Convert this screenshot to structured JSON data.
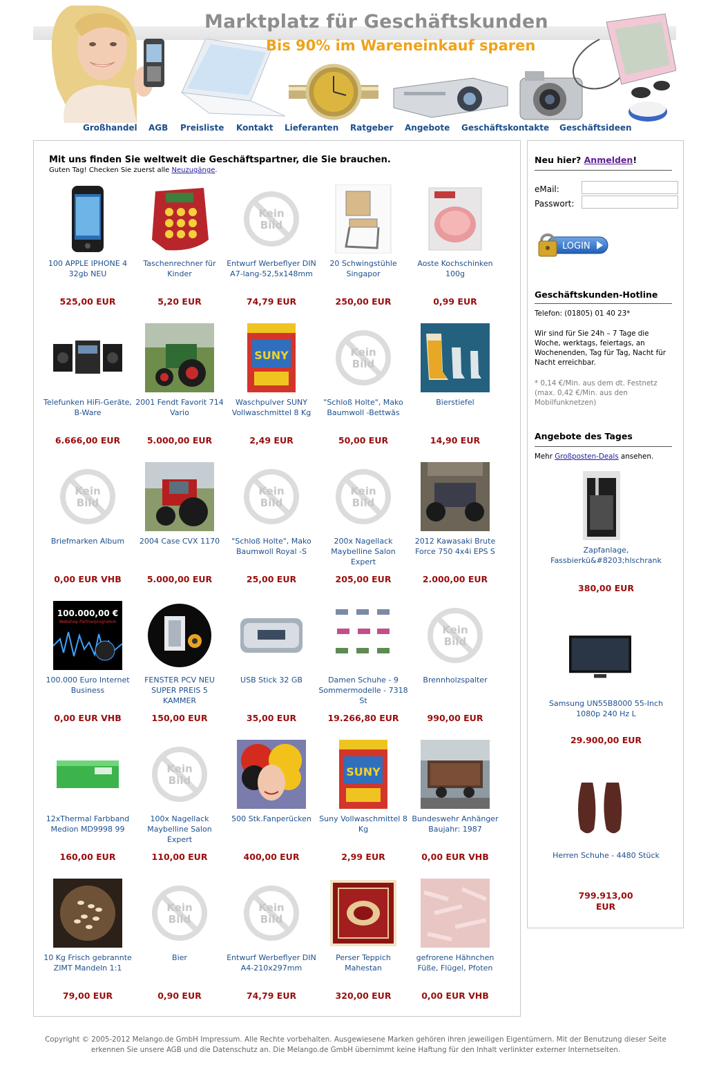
{
  "banner": {
    "title": "Marktplatz für Geschäftskunden",
    "subtitle": "Bis 90% im Wareneinkauf sparen"
  },
  "nav": [
    {
      "label": "Großhandel"
    },
    {
      "label": "AGB"
    },
    {
      "label": "Preisliste"
    },
    {
      "label": "Kontakt"
    },
    {
      "label": "Lieferanten"
    },
    {
      "label": "Ratgeber"
    },
    {
      "label": "Angebote"
    },
    {
      "label": "Geschäftskontakte"
    },
    {
      "label": "Geschäftsideen"
    }
  ],
  "main": {
    "headline": "Mit uns finden Sie weltweit die Geschäftspartner, die Sie brauchen.",
    "greeting_prefix": "Guten Tag! Checken Sie zuerst alle ",
    "greeting_link": "Neuzugänge",
    "greeting_suffix": ".",
    "no_image_label": "Kein Bild",
    "products": [
      {
        "name": "100 APPLE IPHONE 4 32gb NEU",
        "price": "525,00 EUR",
        "image": "iphone"
      },
      {
        "name": "Taschenrechner für Kinder",
        "price": "5,20 EUR",
        "image": "calculator"
      },
      {
        "name": "Entwurf Werbeflyer DIN A7-lang-52,5x148mm",
        "price": "74,79 EUR",
        "image": "none"
      },
      {
        "name": "20 Schwingstühle Singapor",
        "price": "250,00 EUR",
        "image": "chair"
      },
      {
        "name": "Aoste Kochschinken 100g",
        "price": "0,99 EUR",
        "image": "ham"
      },
      {
        "name": "Telefunken HiFi-Geräte, B-Ware",
        "price": "6.666,00 EUR",
        "image": "hifi"
      },
      {
        "name": "2001 Fendt Favorit 714 Vario",
        "price": "5.000,00 EUR",
        "image": "tractor-green"
      },
      {
        "name": "Waschpulver SUNY Vollwaschmittel 8 Kg",
        "price": "2,49 EUR",
        "image": "detergent"
      },
      {
        "name": "\"Schloß Holte\", Mako Baumwoll -Bettwäs",
        "price": "50,00 EUR",
        "image": "none"
      },
      {
        "name": "Bierstiefel",
        "price": "14,90 EUR",
        "image": "beerboot"
      },
      {
        "name": "Briefmarken Album",
        "price": "0,00 EUR VHB",
        "image": "none"
      },
      {
        "name": "2004 Case CVX 1170",
        "price": "5.000,00 EUR",
        "image": "tractor-red"
      },
      {
        "name": "\"Schloß Holte\", Mako Baumwoll Royal -S",
        "price": "25,00 EUR",
        "image": "none"
      },
      {
        "name": "200x Nagellack Maybelline Salon Expert",
        "price": "205,00 EUR",
        "image": "none"
      },
      {
        "name": "2012 Kawasaki Brute Force 750 4x4i EPS S",
        "price": "2.000,00 EUR",
        "image": "atv"
      },
      {
        "name": "100.000 Euro Internet Business",
        "price": "0,00 EUR VHB",
        "image": "business"
      },
      {
        "name": "FENSTER PCV NEU SUPER PREIS  5 KAMMER",
        "price": "150,00 EUR",
        "image": "window"
      },
      {
        "name": "USB Stick 32 GB",
        "price": "35,00 EUR",
        "image": "usb"
      },
      {
        "name": "Damen Schuhe - 9 Sommermodelle - 7318 St",
        "price": "19.266,80 EUR",
        "image": "shoes-women"
      },
      {
        "name": "Brennholzspalter",
        "price": "990,00 EUR",
        "image": "none"
      },
      {
        "name": "12xThermal Farbband Medion MD9998 99",
        "price": "160,00 EUR",
        "image": "ribbon"
      },
      {
        "name": "100x Nagellack Maybelline Salon Expert",
        "price": "110,00 EUR",
        "image": "none"
      },
      {
        "name": "500 Stk.Fanperücken",
        "price": "400,00 EUR",
        "image": "wig"
      },
      {
        "name": "Suny Vollwaschmittel 8 Kg",
        "price": "2,99 EUR",
        "image": "detergent"
      },
      {
        "name": "Bundeswehr Anhänger Baujahr: 1987",
        "price": "0,00 EUR VHB",
        "image": "trailer"
      },
      {
        "name": "10 Kg Frisch gebrannte ZIMT Mandeln 1:1",
        "price": "79,00 EUR",
        "image": "almonds"
      },
      {
        "name": "Bier",
        "price": "0,90 EUR",
        "image": "none"
      },
      {
        "name": "Entwurf Werbeflyer DIN A4-210x297mm",
        "price": "74,79 EUR",
        "image": "none"
      },
      {
        "name": "Perser Teppich Mahestan",
        "price": "320,00 EUR",
        "image": "carpet"
      },
      {
        "name": "gefrorene Hähnchen Füße, Flügel, Pfoten",
        "price": "0,00 EUR VHB",
        "image": "chicken"
      }
    ]
  },
  "sidebar": {
    "register_prefix": "Neu hier? ",
    "register_link": "Anmelden",
    "register_suffix": "!",
    "email_label": "eMail:",
    "password_label": "Passwort:",
    "login_label": "LOGIN",
    "hotline_title": "Geschäftskunden-Hotline",
    "hotline_phone": "Telefon: (01805) 01 40 23*",
    "hotline_text": "Wir sind für Sie 24h – 7 Tage die Woche, werktags, feiertags, an Wochenenden, Tag für Tag, Nacht für Nacht erreichbar.",
    "hotline_note": "* 0,14 €/Min. aus dem dt. Festnetz (max. 0,42 €/Min. aus den Mobilfunknetzen)",
    "deals_title": "Angebote des Tages",
    "deals_more_prefix": "Mehr ",
    "deals_more_link": "Großposten-Deals",
    "deals_more_suffix": " ansehen.",
    "deals": [
      {
        "name": "Zapfanlage, Fassbierkü&#8203;hlschrank",
        "price": "380,00 EUR",
        "image": "zapfanlage"
      },
      {
        "name": "Samsung UN55B8000 55-Inch 1080p 240 Hz L",
        "price": "29.900,00 EUR",
        "image": "tv"
      },
      {
        "name": "Herren Schuhe - 4480 Stück",
        "price": "799.913,00 EUR",
        "image": "shoes-men"
      }
    ]
  },
  "footer": {
    "text": "Copyright © 2005-2012 Melango.de GmbH Impressum. Alle Rechte vorbehalten. Ausgewiesene Marken gehören ihren jeweiligen Eigentümern. Mit der Benutzung dieser Seite erkennen Sie unsere AGB und die Datenschutz an. Die Melango.de GmbH übernimmt keine Haftung für den Inhalt verlinkter externer Internetseiten."
  }
}
